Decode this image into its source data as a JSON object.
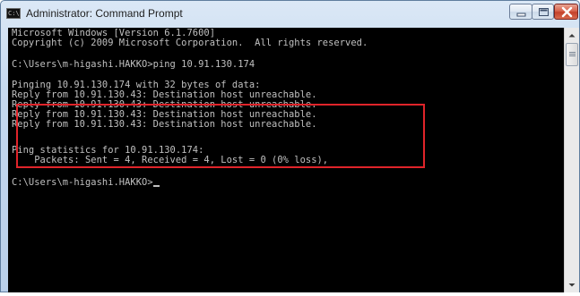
{
  "window": {
    "title": "Administrator: Command Prompt",
    "icon_label": "C:\\",
    "controls": {
      "minimize": "minimize-icon",
      "maximize": "maximize-icon",
      "close": "close-icon"
    }
  },
  "console": {
    "lines": [
      "Microsoft Windows [Version 6.1.7600]",
      "Copyright (c) 2009 Microsoft Corporation.  All rights reserved.",
      "",
      "C:\\Users\\m-higashi.HAKKO>ping 10.91.130.174",
      "",
      "Pinging 10.91.130.174 with 32 bytes of data:",
      "Reply from 10.91.130.43: Destination host unreachable.",
      "Reply from 10.91.130.43: Destination host unreachable.",
      "Reply from 10.91.130.43: Destination host unreachable.",
      "Reply from 10.91.130.43: Destination host unreachable.",
      "",
      "Ping statistics for 10.91.130.174:",
      "    Packets: Sent = 4, Received = 4, Lost = 0 (0% loss),",
      "",
      "C:\\Users\\m-higashi.HAKKO>"
    ]
  },
  "colors": {
    "console_background": "#000000",
    "console_text": "#c0c0c0",
    "highlight_border": "#e0242a"
  },
  "scrollbar": {
    "up_icon": "scroll-up-arrow-icon",
    "down_icon": "scroll-down-arrow-icon"
  }
}
